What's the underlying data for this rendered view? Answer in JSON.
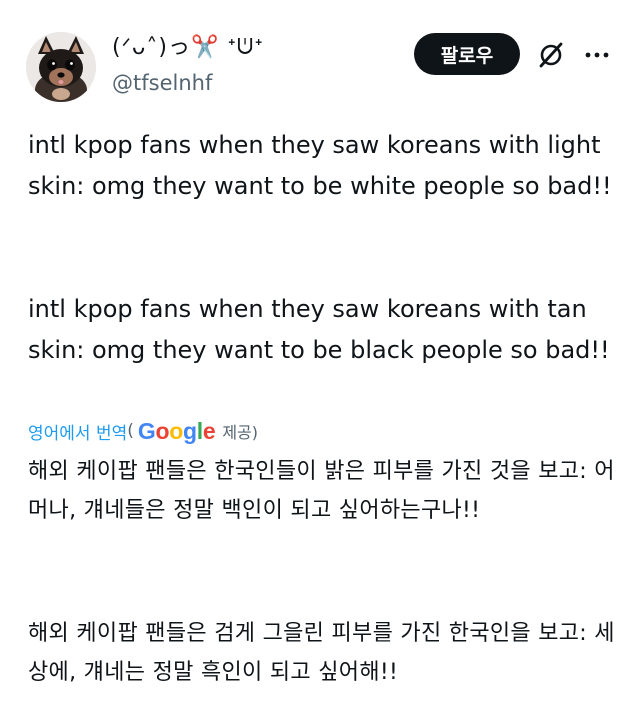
{
  "tweet": {
    "author": {
      "display_name": "(ᐟᴗ˄)っ✂️ ᕀᕫᕀ",
      "handle": "@tfselnhf",
      "avatar": "chihuahua-puppy-photo"
    },
    "actions": {
      "follow_label": "팔로우",
      "grok_icon": "grok-icon",
      "more_icon": "more-icon"
    },
    "text": {
      "paragraph_1": "intl kpop fans when they saw koreans with light skin: omg they want to be white people so bad!!",
      "paragraph_2": "intl kpop fans when they saw koreans with tan skin: omg they want to be black people so bad!!"
    },
    "translation": {
      "link_label": "영어에서 번역",
      "open_paren": "(",
      "provider": "Google",
      "provided_label": "제공)",
      "paragraph_1": "해외 케이팝 팬들은 한국인들이 밝은 피부를 가진 것을 보고: 어머나, 걔네들은 정말 백인이 되고 싶어하는구나!!",
      "paragraph_2": "해외 케이팝 팬들은 검게 그을린 피부를 가진 한국인을 보고: 세상에, 걔네는 정말 흑인이 되고 싶어해!!"
    }
  },
  "colors": {
    "text": "#0f1419",
    "secondary": "#536471",
    "link": "#1d9bf0",
    "google_blue": "#4285f4",
    "google_red": "#ea4335",
    "google_yellow": "#fbbc05",
    "google_green": "#34a853"
  }
}
